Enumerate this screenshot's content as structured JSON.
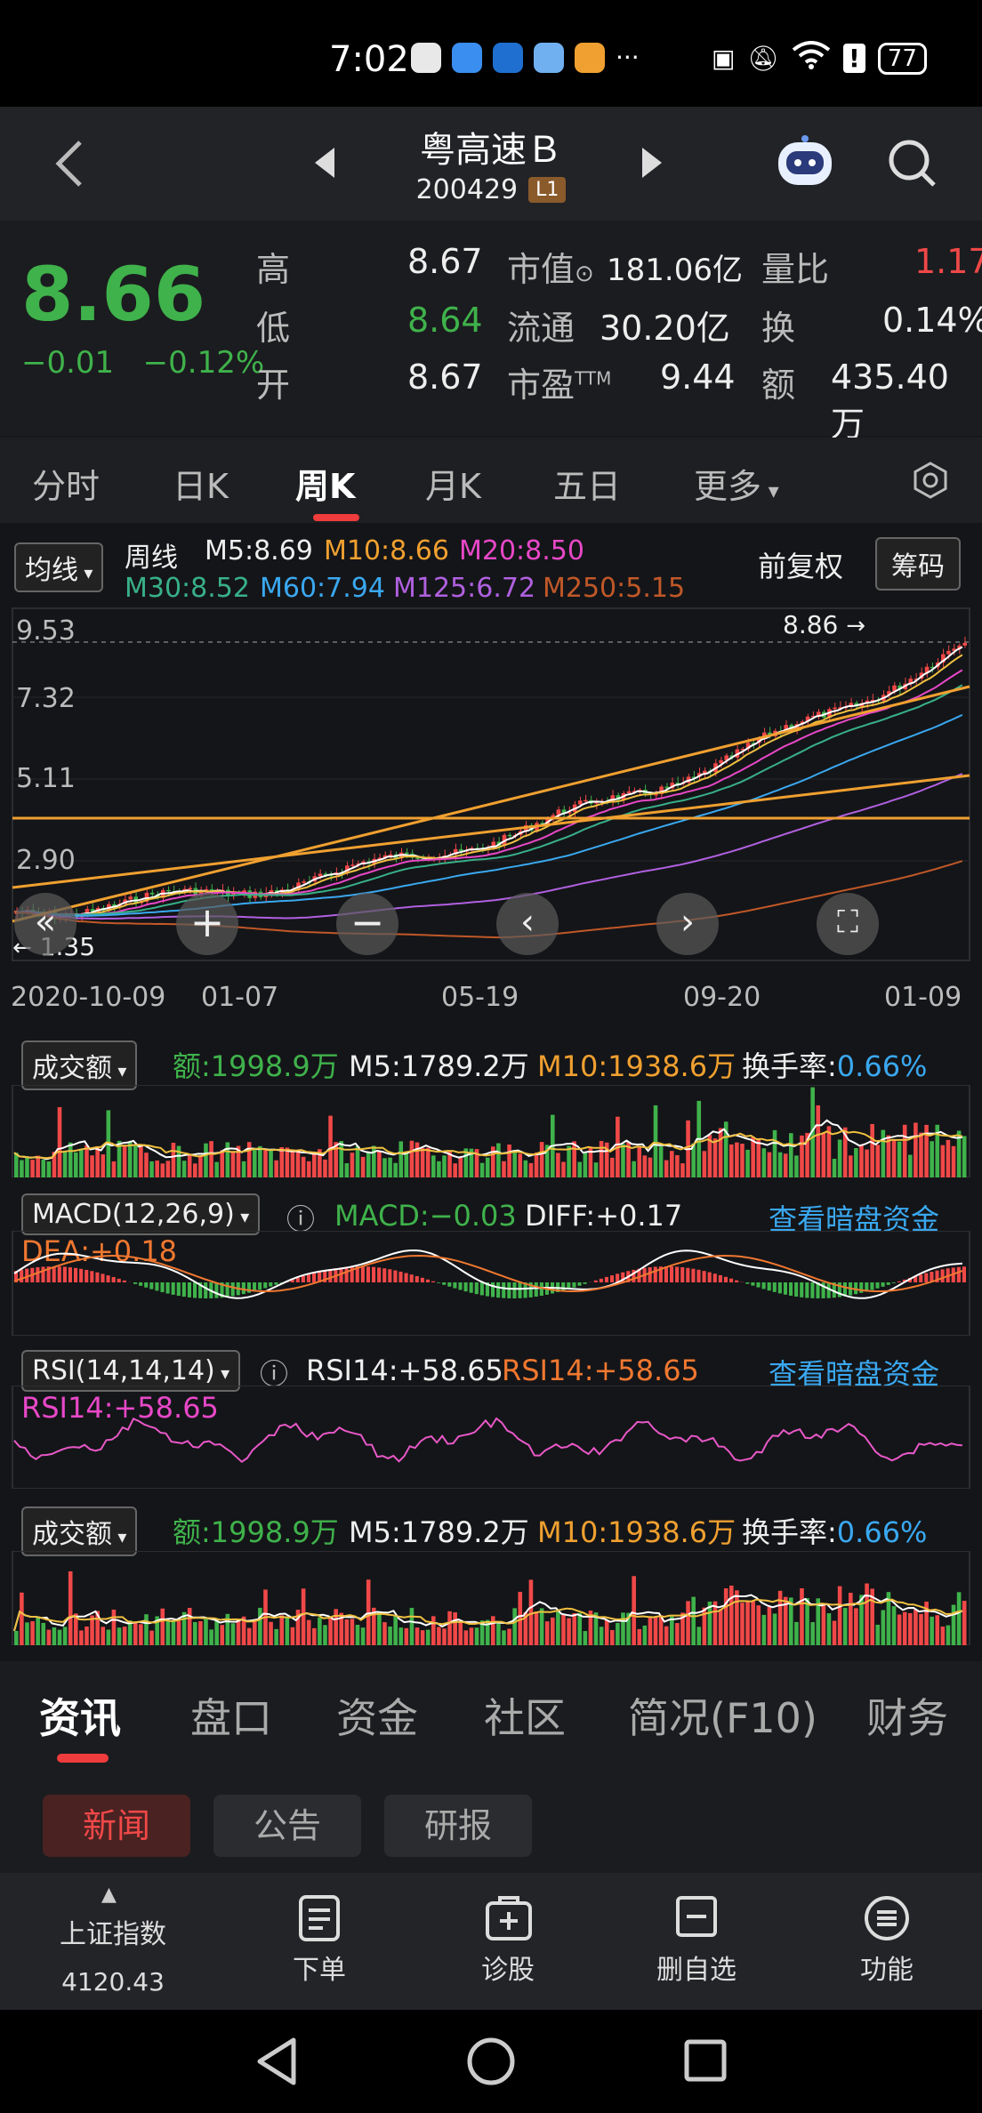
{
  "status": {
    "time": "7:02",
    "battery": "77"
  },
  "header": {
    "name": "粤高速Ｂ",
    "code": "200429",
    "level_badge": "L1"
  },
  "quote": {
    "price": "8.66",
    "change": "−0.01",
    "change_pct": "−0.12%",
    "high_label": "高",
    "high": "8.67",
    "low_label": "低",
    "low": "8.64",
    "open_label": "开",
    "open": "8.67",
    "mktcap_label": "市值",
    "mktcap": "181.06亿",
    "float_label": "流通",
    "float": "30.20亿",
    "pe_label": "市盈",
    "pe_sup": "TTM",
    "pe": "9.44",
    "volratio_label": "量比",
    "volratio": "1.17",
    "turnover_label": "换",
    "turnover": "0.14%",
    "amount_label": "额",
    "amount": "435.40万"
  },
  "tabs": [
    "分时",
    "日K",
    "周K",
    "月K",
    "五日",
    "更多"
  ],
  "active_tab": "周K",
  "ma": {
    "selector": "均线",
    "period": "周线",
    "m5": "M5:8.69",
    "m10": "M10:8.66",
    "m20": "M20:8.50",
    "m30": "M30:8.52",
    "m60": "M60:7.94",
    "m125": "M125:6.72",
    "m250": "M250:5.15",
    "adjust": "前复权",
    "chip_button": "筹码"
  },
  "price_axis": [
    "9.53",
    "7.32",
    "5.11",
    "2.90"
  ],
  "max_label": "8.86",
  "min_label": "1.35",
  "date_axis": [
    "2020-10-09",
    "01-07",
    "05-19",
    "09-20",
    "01-09"
  ],
  "volume_panel": {
    "selector": "成交额",
    "amount": "额:1998.9万",
    "m5": "M5:1789.2万",
    "m10": "M10:1938.6万",
    "turnover_label": "换手率:",
    "turnover": "0.66%"
  },
  "macd_panel": {
    "selector": "MACD(12,26,9)",
    "macd": "MACD:−0.03",
    "diff": "DIFF:+0.17",
    "dea": "DEA:+0.18",
    "link": "查看暗盘资金"
  },
  "rsi_panel": {
    "selector": "RSI(14,14,14)",
    "rsi1": "RSI14:+58.65",
    "rsi2": "RSI14:+58.65",
    "rsi3": "RSI14:+58.65",
    "link": "查看暗盘资金"
  },
  "news_tabs": [
    "资讯",
    "盘口",
    "资金",
    "社区",
    "简况(F10)",
    "财务"
  ],
  "sub_tabs": [
    "新闻",
    "公告",
    "研报"
  ],
  "bottom_bar": {
    "index_name": "上证指数",
    "index_value": "4120.43",
    "order": "下单",
    "diagnose": "诊股",
    "remove_fav": "删自选",
    "functions": "功能"
  },
  "colors": {
    "up": "#f04848",
    "down": "#3fb24b",
    "accent": "#f03c3c"
  }
}
